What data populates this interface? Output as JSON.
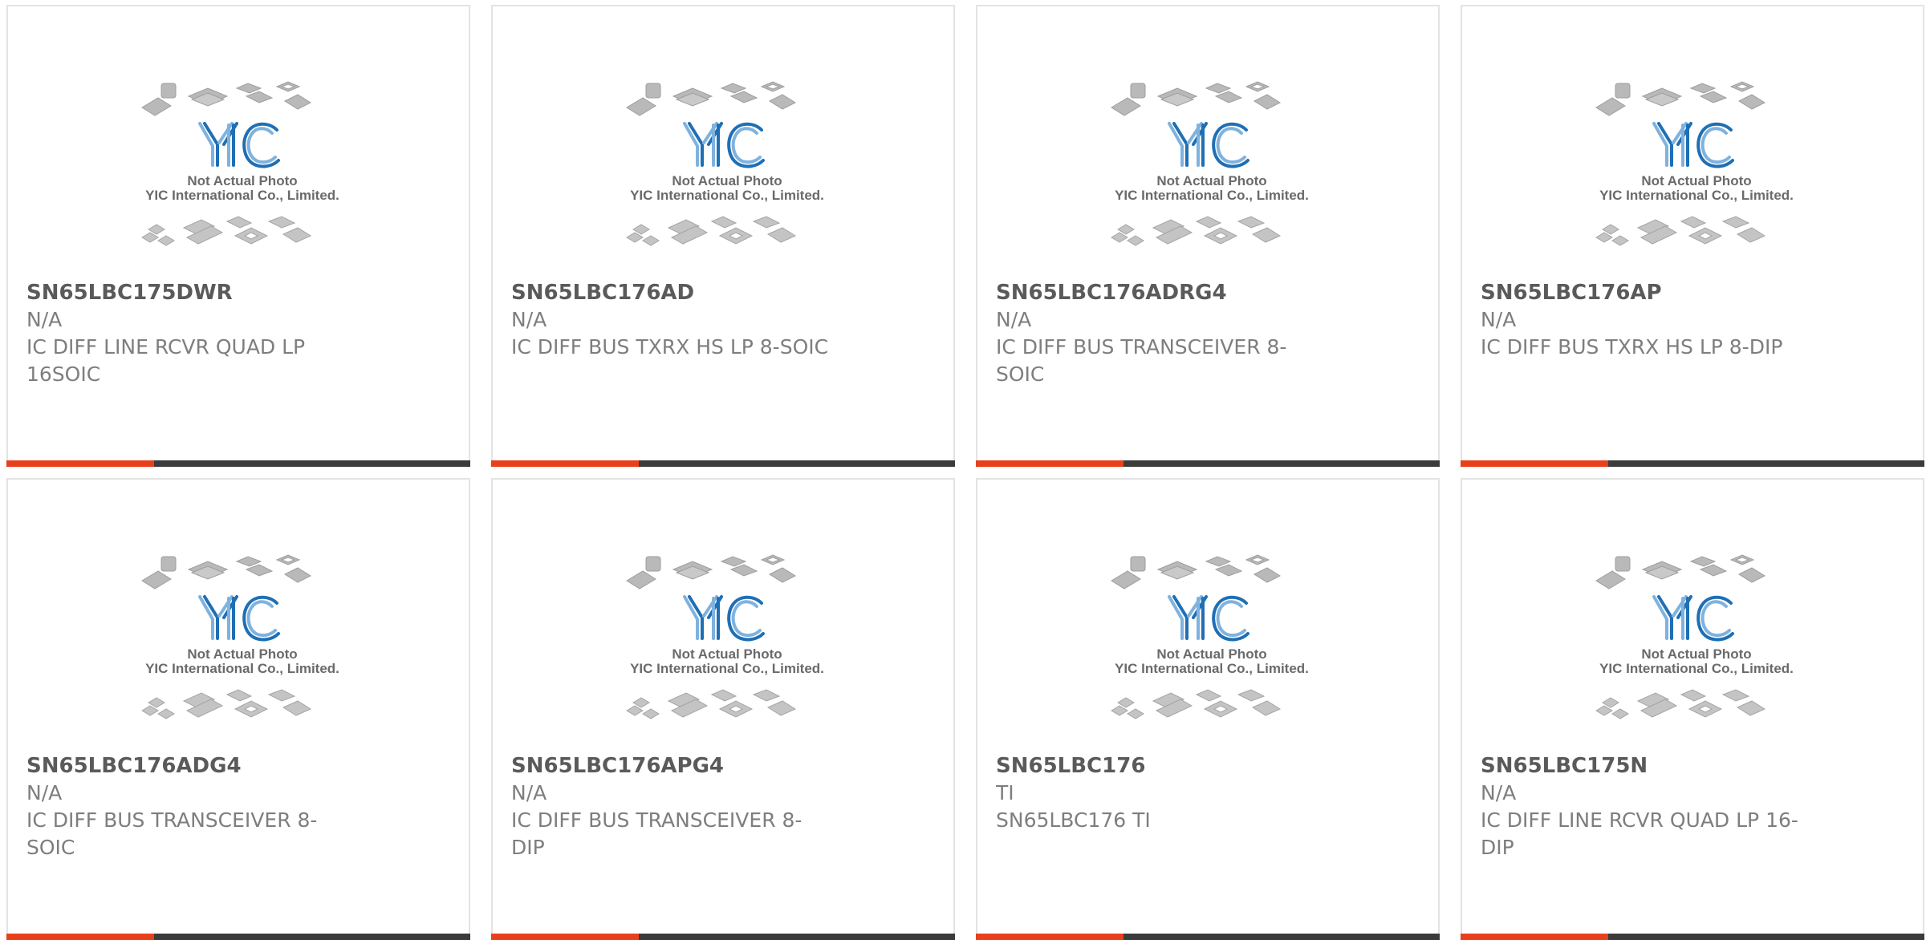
{
  "theme": {
    "accent_color": "#e8401c",
    "bar_color": "#3b3b3b",
    "logo_color": "#1f6fb5"
  },
  "placeholder_image": {
    "logo_text": "YIC",
    "caption_line1": "Not Actual Photo",
    "caption_line2": "YIC International Co., Limited."
  },
  "products": [
    {
      "part_number": "SN65LBC175DWR",
      "manufacturer": "N/A",
      "description": "IC DIFF LINE RCVR QUAD LP 16SOIC"
    },
    {
      "part_number": "SN65LBC176AD",
      "manufacturer": "N/A",
      "description": "IC DIFF BUS TXRX HS LP 8-SOIC"
    },
    {
      "part_number": "SN65LBC176ADRG4",
      "manufacturer": "N/A",
      "description": "IC DIFF BUS TRANSCEIVER 8-SOIC"
    },
    {
      "part_number": "SN65LBC176AP",
      "manufacturer": "N/A",
      "description": "IC DIFF BUS TXRX HS LP 8-DIP"
    },
    {
      "part_number": "SN65LBC176ADG4",
      "manufacturer": "N/A",
      "description": "IC DIFF BUS TRANSCEIVER 8-SOIC"
    },
    {
      "part_number": "SN65LBC176APG4",
      "manufacturer": "N/A",
      "description": "IC DIFF BUS TRANSCEIVER 8-DIP"
    },
    {
      "part_number": "SN65LBC176",
      "manufacturer": "TI",
      "description": "SN65LBC176 TI"
    },
    {
      "part_number": "SN65LBC175N",
      "manufacturer": "N/A",
      "description": "IC DIFF LINE RCVR QUAD LP 16-DIP"
    }
  ]
}
